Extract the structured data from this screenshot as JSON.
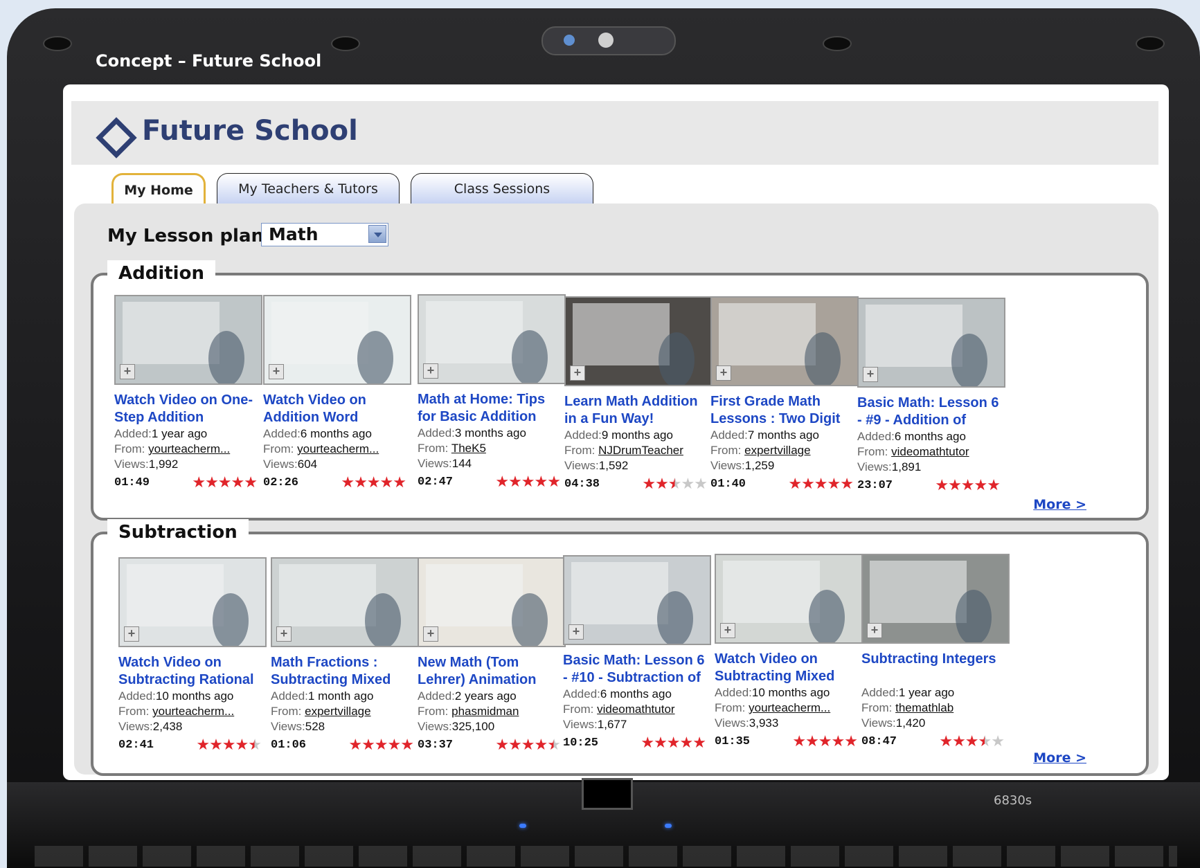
{
  "window": {
    "title": "Concept – Future School",
    "model": "6830s"
  },
  "app": {
    "name": "Future School",
    "logo_icon": "diamond-icon",
    "brand_color": "#2e3f73"
  },
  "tabs": [
    {
      "label": "My Home",
      "active": true
    },
    {
      "label": "My Teachers & Tutors",
      "active": false
    },
    {
      "label": "Class Sessions",
      "active": false
    }
  ],
  "lesson_plan": {
    "label": "My Lesson plan",
    "subject": "Math"
  },
  "colors": {
    "link": "#1d47c4",
    "star": "#e0242a"
  },
  "sections": [
    {
      "title": "Addition",
      "more": "More >",
      "videos": [
        {
          "title": "Watch Video on One-Step Addition",
          "added": "1 year ago",
          "from": "yourteacherm...",
          "views": "1,992",
          "duration": "01:49",
          "rating": 5
        },
        {
          "title": "Watch Video on Addition Word",
          "added": "6 months ago",
          "from": "yourteacherm...",
          "views": "604",
          "duration": "02:26",
          "rating": 5
        },
        {
          "title": "Math at Home: Tips for Basic Addition",
          "added": "3 months ago",
          "from": "TheK5",
          "views": "144",
          "duration": "02:47",
          "rating": 5
        },
        {
          "title": "Learn Math Addition in a Fun Way!",
          "added": "9 months ago",
          "from": "NJDrumTeacher",
          "views": "1,592",
          "duration": "04:38",
          "rating": 2.5
        },
        {
          "title": "First Grade Math Lessons : Two Digit",
          "added": "7 months ago",
          "from": "expertvillage",
          "views": "1,259",
          "duration": "01:40",
          "rating": 5
        },
        {
          "title": "Basic Math: Lesson 6 - #9 - Addition of",
          "added": "6 months ago",
          "from": "videomathtutor",
          "views": "1,891",
          "duration": "23:07",
          "rating": 5
        }
      ]
    },
    {
      "title": "Subtraction",
      "more": "More >",
      "videos": [
        {
          "title": "Watch Video on Subtracting Rational",
          "added": "10 months ago",
          "from": "yourteacherm...",
          "views": "2,438",
          "duration": "02:41",
          "rating": 4.5
        },
        {
          "title": "Math Fractions : Subtracting Mixed",
          "added": "1 month ago",
          "from": "expertvillage",
          "views": "528",
          "duration": "01:06",
          "rating": 5
        },
        {
          "title": "New Math (Tom Lehrer) Animation",
          "added": "2 years ago",
          "from": "phasmidman",
          "views": "325,100",
          "duration": "03:37",
          "rating": 4.5
        },
        {
          "title": "Basic Math: Lesson 6 - #10 - Subtraction of",
          "added": "6 months ago",
          "from": "videomathtutor",
          "views": "1,677",
          "duration": "10:25",
          "rating": 5
        },
        {
          "title": "Watch Video on Subtracting Mixed",
          "added": "10 months ago",
          "from": "yourteacherm...",
          "views": "3,933",
          "duration": "01:35",
          "rating": 5
        },
        {
          "title": "Subtracting Integers",
          "added": "1 year ago",
          "from": "themathlab",
          "views": "1,420",
          "duration": "08:47",
          "rating": 3.5
        }
      ]
    }
  ],
  "meta_labels": {
    "added": "Added:",
    "from": "From:",
    "views": "Views:"
  }
}
